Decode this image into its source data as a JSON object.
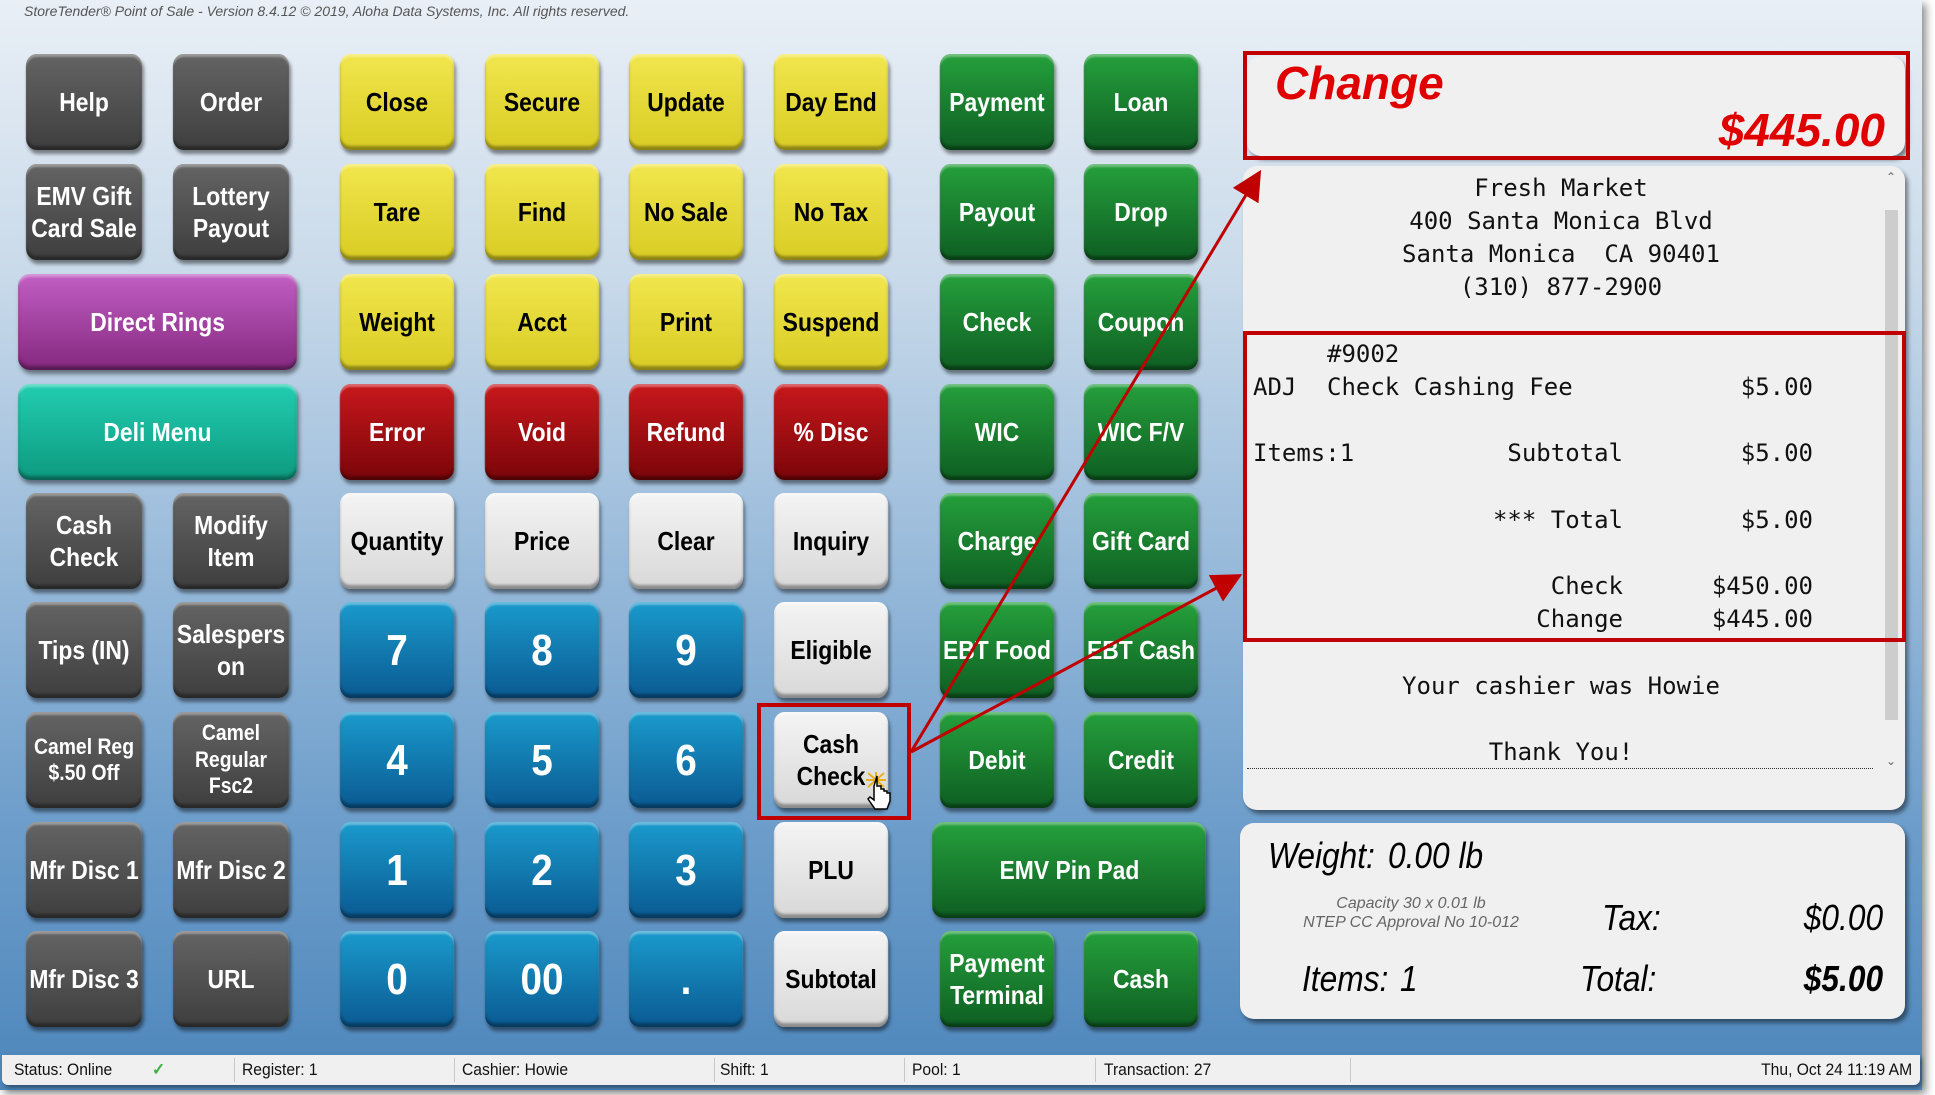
{
  "window": {
    "title": "StoreTender® Point of Sale - Version 8.4.12   © 2019, Aloha Data Systems, Inc. All rights reserved."
  },
  "buttons": {
    "help": "Help",
    "order": "Order",
    "emv_gift_1": "EMV Gift",
    "emv_gift_2": "Card Sale",
    "lottery_1": "Lottery",
    "lottery_2": "Payout",
    "direct_rings": "Direct Rings",
    "deli_menu": "Deli Menu",
    "cash_check_l1": "Cash",
    "cash_check_l2": "Check",
    "modify_item_1": "Modify",
    "modify_item_2": "Item",
    "tips_in": "Tips (IN)",
    "salesperson_1": "Salespers",
    "salesperson_2": "on",
    "camel_reg_1": "Camel Reg",
    "camel_reg_2": "$.50 Off",
    "camel_regular_1": "Camel",
    "camel_regular_2": "Regular",
    "camel_regular_3": "Fsc2",
    "mfr_disc_1": "Mfr Disc 1",
    "mfr_disc_2": "Mfr Disc 2",
    "mfr_disc_3": "Mfr Disc 3",
    "url": "URL",
    "close": "Close",
    "secure": "Secure",
    "update": "Update",
    "day_end": "Day End",
    "tare": "Tare",
    "find": "Find",
    "no_sale": "No Sale",
    "no_tax": "No Tax",
    "weight": "Weight",
    "acct": "Acct",
    "print": "Print",
    "suspend": "Suspend",
    "error": "Error",
    "void": "Void",
    "refund": "Refund",
    "pct_disc": "% Disc",
    "quantity": "Quantity",
    "price": "Price",
    "clear": "Clear",
    "inquiry": "Inquiry",
    "eligible": "Eligible",
    "cash_check_1": "Cash",
    "cash_check_2": "Check",
    "plu": "PLU",
    "subtotal": "Subtotal",
    "k7": "7",
    "k8": "8",
    "k9": "9",
    "k4": "4",
    "k5": "5",
    "k6": "6",
    "k1": "1",
    "k2": "2",
    "k3": "3",
    "k0": "0",
    "k00": "00",
    "kdot": ".",
    "payment": "Payment",
    "loan": "Loan",
    "payout": "Payout",
    "drop": "Drop",
    "check": "Check",
    "coupon": "Coupon",
    "wic": "WIC",
    "wic_fv": "WIC F/V",
    "charge": "Charge",
    "gift_card": "Gift Card",
    "ebt_food": "EBT Food",
    "ebt_cash": "EBT Cash",
    "debit": "Debit",
    "credit": "Credit",
    "emv_pin_pad": "EMV Pin Pad",
    "payment_terminal_1": "Payment",
    "payment_terminal_2": "Terminal",
    "cash": "Cash"
  },
  "change_display": {
    "label": "Change",
    "amount": "$445.00"
  },
  "receipt": {
    "store_name": "Fresh Market",
    "address_1": "400 Santa Monica Blvd",
    "address_2": "Santa Monica  CA 90401",
    "phone": "(310) 877-2900",
    "txn_no": "#9002",
    "line_item": {
      "code": "ADJ",
      "desc": "Check Cashing Fee",
      "amount": "$5.00"
    },
    "items_count": "Items:1",
    "subtotal_label": "Subtotal",
    "subtotal": "$5.00",
    "total_label": "*** Total",
    "total": "$5.00",
    "check_label": "Check",
    "check": "$450.00",
    "change_label": "Change",
    "change": "$445.00",
    "cashier_line": "Your cashier was Howie",
    "thanks": "Thank You!"
  },
  "totals": {
    "weight_label": "Weight:",
    "weight_value": "0.00 lb",
    "capacity": "Capacity 30 x 0.01 lb",
    "ntep": "NTEP CC Approval No 10-012",
    "items_label": "Items:",
    "items_value": "1",
    "tax_label": "Tax:",
    "tax_value": "$0.00",
    "total_label": "Total:",
    "total_value": "$5.00"
  },
  "status_bar": {
    "status": "Status: Online",
    "status_ok": "✓",
    "register": "Register: 1",
    "cashier": "Cashier: Howie",
    "shift": "Shift: 1",
    "pool": "Pool: 1",
    "transaction": "Transaction: 27",
    "datetime": "Thu, Oct 24  11:19 AM"
  },
  "colors": {
    "annotation_red": "#c00000",
    "change_red": "#e00000",
    "online_green": "#3cb043"
  }
}
